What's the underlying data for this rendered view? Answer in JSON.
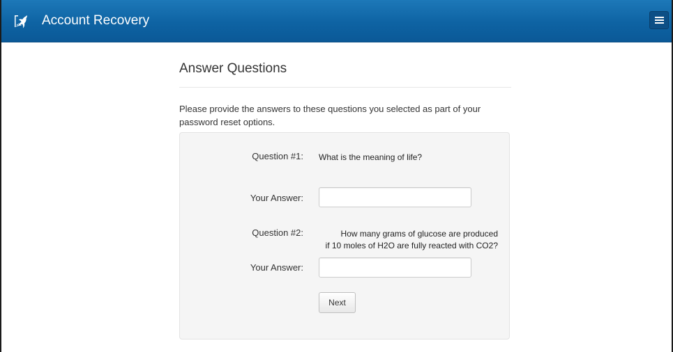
{
  "header": {
    "title": "Account Recovery",
    "logo_icon": "bird-logo-icon",
    "menu_icon": "hamburger-menu-icon",
    "brand_color": "#0e63a3"
  },
  "main": {
    "page_title": "Answer Questions",
    "instructions": "Please provide the answers to these questions you selected as part of your password reset options."
  },
  "form": {
    "questions": [
      {
        "label": "Question #1:",
        "lines": [
          "What is the meaning of life?"
        ],
        "answer_label": "Your Answer:",
        "answer_value": ""
      },
      {
        "label": "Question #2:",
        "lines": [
          "How many grams of glucose are produced",
          "if 10 moles of H2O are fully reacted with CO2?"
        ],
        "answer_label": "Your Answer:",
        "answer_value": ""
      }
    ],
    "next_label": "Next"
  }
}
